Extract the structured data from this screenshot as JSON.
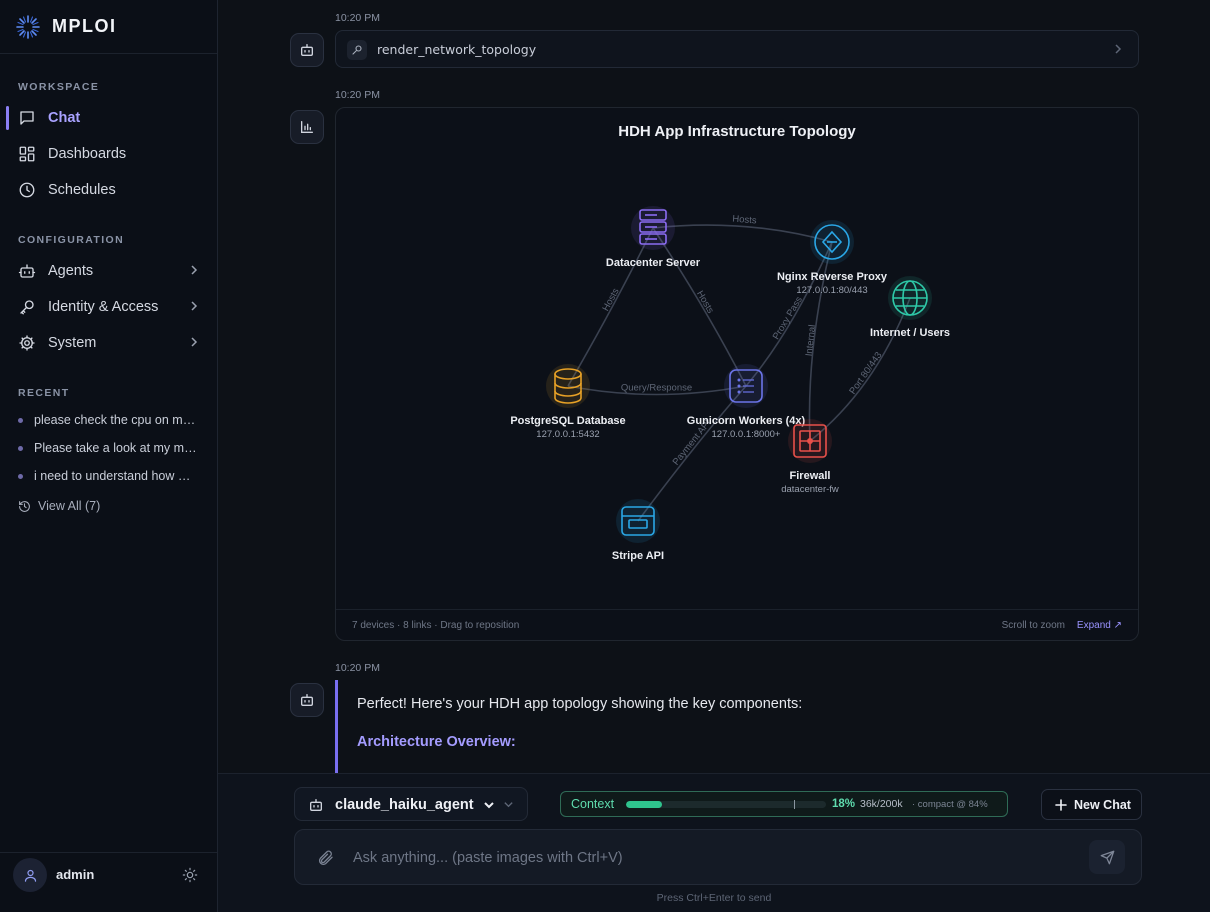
{
  "app": {
    "name": "MPLOI"
  },
  "sidebar": {
    "workspace_label": "WORKSPACE",
    "workspace": [
      {
        "label": "Chat",
        "icon": "message-square-icon",
        "active": true
      },
      {
        "label": "Dashboards",
        "icon": "grid-icon"
      },
      {
        "label": "Schedules",
        "icon": "clock-icon"
      }
    ],
    "configuration_label": "CONFIGURATION",
    "configuration": [
      {
        "label": "Agents",
        "icon": "bot-icon"
      },
      {
        "label": "Identity & Access",
        "icon": "key-icon"
      },
      {
        "label": "System",
        "icon": "gear-icon"
      }
    ],
    "recent_label": "RECENT",
    "recent": [
      "please check the cpu on my server",
      "Please take a look at my metrics",
      "i need to understand how my app works"
    ],
    "view_all": "View All (7)",
    "user": {
      "name": "admin"
    }
  },
  "conversation": {
    "tool_call": {
      "time": "10:20 PM",
      "name": "render_network_topology"
    },
    "topology": {
      "time": "10:20 PM",
      "title": "HDH App Infrastructure Topology",
      "footer_left": "7 devices · 8 links · Drag to reposition",
      "footer_zoom": "Scroll to zoom",
      "footer_expand": "Expand ↗",
      "nodes": [
        {
          "id": "dc",
          "label": "Datacenter Server",
          "sub": "",
          "type": "server",
          "color": "#8b6cf2"
        },
        {
          "id": "nginx",
          "label": "Nginx Reverse Proxy",
          "sub": "127.0.0.1:80/443",
          "type": "proxy",
          "color": "#2aa7e6"
        },
        {
          "id": "internet",
          "label": "Internet / Users",
          "sub": "",
          "type": "globe",
          "color": "#2ec9a8"
        },
        {
          "id": "pg",
          "label": "PostgreSQL Database",
          "sub": "127.0.0.1:5432",
          "type": "database",
          "color": "#e7a126"
        },
        {
          "id": "gunicorn",
          "label": "Gunicorn Workers (4x)",
          "sub": "127.0.0.1:8000+",
          "type": "app",
          "color": "#6b74e8"
        },
        {
          "id": "firewall",
          "label": "Firewall",
          "sub": "datacenter-fw",
          "type": "firewall",
          "color": "#e8504a"
        },
        {
          "id": "stripe",
          "label": "Stripe API",
          "sub": "",
          "type": "api",
          "color": "#2aa7e6"
        }
      ],
      "links": [
        {
          "from": "dc",
          "to": "nginx",
          "label": "Hosts"
        },
        {
          "from": "dc",
          "to": "pg",
          "label": "Hosts"
        },
        {
          "from": "dc",
          "to": "gunicorn",
          "label": "Hosts"
        },
        {
          "from": "pg",
          "to": "gunicorn",
          "label": "Query/Response"
        },
        {
          "from": "nginx",
          "to": "gunicorn",
          "label": "Proxy Pass"
        },
        {
          "from": "nginx",
          "to": "firewall",
          "label": "Internal"
        },
        {
          "from": "internet",
          "to": "firewall",
          "label": "Port 80/443"
        },
        {
          "from": "gunicorn",
          "to": "stripe",
          "label": "Payment API"
        }
      ]
    },
    "reply": {
      "time": "10:20 PM",
      "text": "Perfect! Here's your HDH app topology showing the key components:",
      "heading": "Architecture Overview:"
    }
  },
  "composer": {
    "agent": "claude_haiku_agent",
    "context": {
      "label": "Context",
      "percent": 18,
      "tokens": "36k/200k",
      "compact": "· compact @ 84%",
      "compact_threshold": 84
    },
    "new_chat": "New Chat",
    "placeholder": "Ask anything... (paste images with Ctrl+V)",
    "hint": "Press Ctrl+Enter to send"
  },
  "colors": {
    "accent": "#8b7ff5",
    "context": "#2fc48d"
  }
}
